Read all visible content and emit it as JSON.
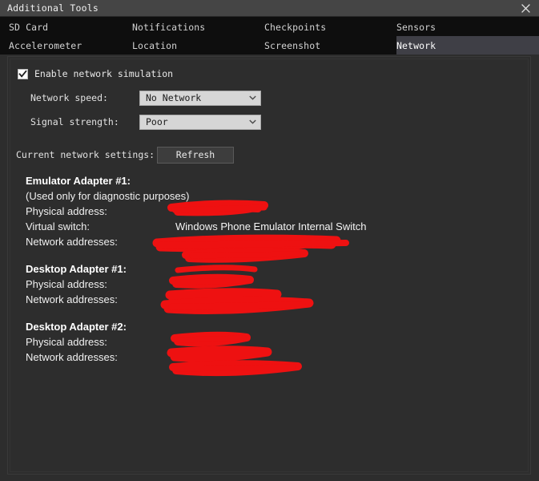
{
  "window": {
    "title": "Additional Tools",
    "close_icon": "close-icon"
  },
  "tabs": {
    "row1": [
      {
        "label": "SD Card",
        "selected": false
      },
      {
        "label": "Notifications",
        "selected": false
      },
      {
        "label": "Checkpoints",
        "selected": false
      },
      {
        "label": "Sensors",
        "selected": false
      }
    ],
    "row2": [
      {
        "label": "Accelerometer",
        "selected": false
      },
      {
        "label": "Location",
        "selected": false
      },
      {
        "label": "Screenshot",
        "selected": false
      },
      {
        "label": "Network",
        "selected": true
      }
    ]
  },
  "network": {
    "enable_label": "Enable network simulation",
    "enable_checked": true,
    "speed_label": "Network speed:",
    "speed_value": "No Network",
    "signal_label": "Signal strength:",
    "signal_value": "Poor",
    "settings_label": "Current network settings:",
    "refresh_label": "Refresh",
    "dropdown_icon": "chevron-down-icon",
    "check_icon": "checkmark-icon"
  },
  "report": {
    "adapters": [
      {
        "title": "Emulator Adapter #1:",
        "note": "(Used only for diagnostic purposes)",
        "lines": [
          {
            "key": "Physical address:",
            "value": "",
            "redacted": true
          },
          {
            "key": "Virtual switch:",
            "value": "Windows Phone Emulator Internal Switch",
            "redacted": false
          },
          {
            "key": "Network addresses:",
            "value": "",
            "redacted": true
          }
        ]
      },
      {
        "title": "Desktop Adapter #1:",
        "note": "",
        "lines": [
          {
            "key": "Physical address:",
            "value": "",
            "redacted": true
          },
          {
            "key": "Network addresses:",
            "value": "",
            "redacted": true
          }
        ]
      },
      {
        "title": "Desktop Adapter #2:",
        "note": "",
        "lines": [
          {
            "key": "Physical address:",
            "value": "",
            "redacted": true
          },
          {
            "key": "Network addresses:",
            "value": "",
            "redacted": true
          }
        ]
      }
    ]
  },
  "colors": {
    "window_bg": "#2d2d2d",
    "titlebar_bg": "#454545",
    "tabstrip_bg": "#0e0e0e",
    "tab_selected_bg": "#3f3f46",
    "combo_bg": "#d6d6d6",
    "redaction": "#ee1111",
    "text": "#f0f0f0"
  }
}
